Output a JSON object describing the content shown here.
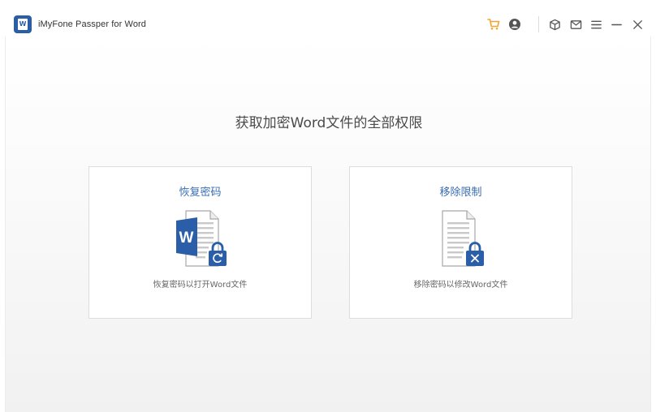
{
  "window": {
    "title": "iMyFone Passper for Word",
    "logo_letter": "W"
  },
  "toolbar": {
    "icons": [
      "cart-icon",
      "user-icon",
      "box-icon",
      "mail-icon",
      "menu-icon",
      "minimize-icon",
      "close-icon"
    ],
    "accent_cart": "#f2a531",
    "icon_color": "#555555"
  },
  "main": {
    "heading": "获取加密Word文件的全部权限",
    "cards": [
      {
        "title": "恢复密码",
        "description": "恢复密码以打开Word文件",
        "icon": "word-doc-lock-refresh-icon"
      },
      {
        "title": "移除限制",
        "description": "移除密码以修改Word文件",
        "icon": "doc-lock-remove-icon"
      }
    ]
  },
  "colors": {
    "brand_blue": "#2b5ea8",
    "title_blue": "#3a6cb3"
  }
}
